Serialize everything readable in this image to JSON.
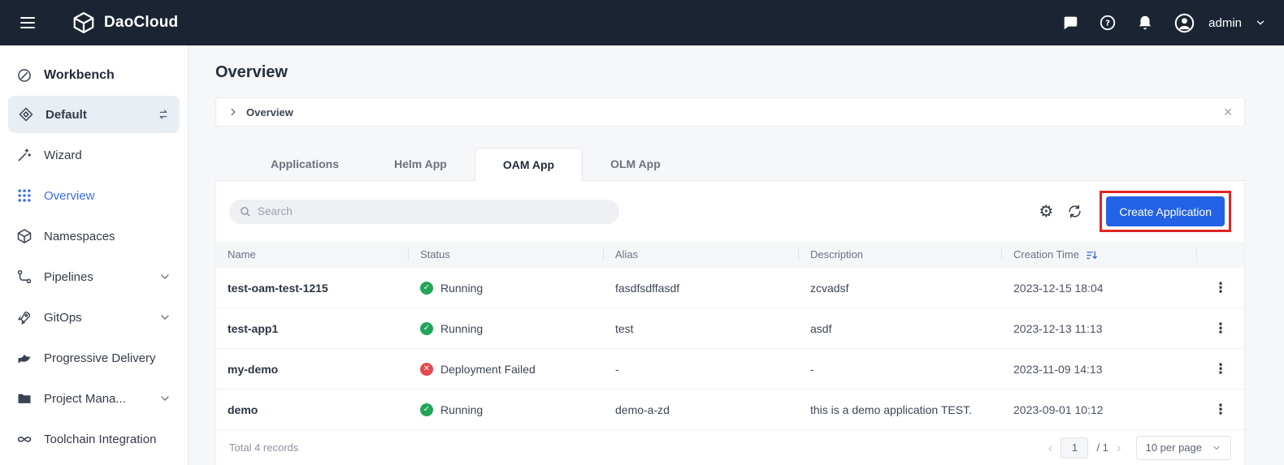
{
  "header": {
    "brand": "DaoCloud",
    "user": "admin"
  },
  "sidebar": {
    "items": [
      {
        "label": "Workbench"
      },
      {
        "label": "Default"
      },
      {
        "label": "Wizard"
      },
      {
        "label": "Overview"
      },
      {
        "label": "Namespaces"
      },
      {
        "label": "Pipelines"
      },
      {
        "label": "GitOps"
      },
      {
        "label": "Progressive Delivery"
      },
      {
        "label": "Project Mana..."
      },
      {
        "label": "Toolchain Integration"
      }
    ]
  },
  "main": {
    "page_title": "Overview",
    "breadcrumb": {
      "label": "Overview"
    },
    "tabs": [
      {
        "label": "Applications"
      },
      {
        "label": "Helm App"
      },
      {
        "label": "OAM App"
      },
      {
        "label": "OLM App"
      }
    ],
    "toolbar": {
      "search_placeholder": "Search",
      "create_label": "Create Application"
    },
    "table": {
      "columns": {
        "name": "Name",
        "status": "Status",
        "alias": "Alias",
        "description": "Description",
        "creation_time": "Creation Time"
      },
      "rows": [
        {
          "name": "test-oam-test-1215",
          "status": "Running",
          "status_type": "success",
          "alias": "fasdfsdffasdf",
          "description": "zcvadsf",
          "creation_time": "2023-12-15 18:04"
        },
        {
          "name": "test-app1",
          "status": "Running",
          "status_type": "success",
          "alias": "test",
          "description": "asdf",
          "creation_time": "2023-12-13 11:13"
        },
        {
          "name": "my-demo",
          "status": "Deployment Failed",
          "status_type": "error",
          "alias": "-",
          "description": "-",
          "creation_time": "2023-11-09 14:13"
        },
        {
          "name": "demo",
          "status": "Running",
          "status_type": "success",
          "alias": "demo-a-zd",
          "description": "this is a demo application TEST.",
          "creation_time": "2023-09-01 10:12"
        }
      ]
    },
    "pagination": {
      "total_label": "Total 4 records",
      "current_page": "1",
      "total_pages": "/ 1",
      "page_size_label": "10 per page"
    }
  },
  "colors": {
    "topbar": "#1a2433",
    "accent_blue": "#2262e6",
    "success_green": "#21a558",
    "error_red": "#e5484d",
    "annotation_red": "#e12424"
  }
}
